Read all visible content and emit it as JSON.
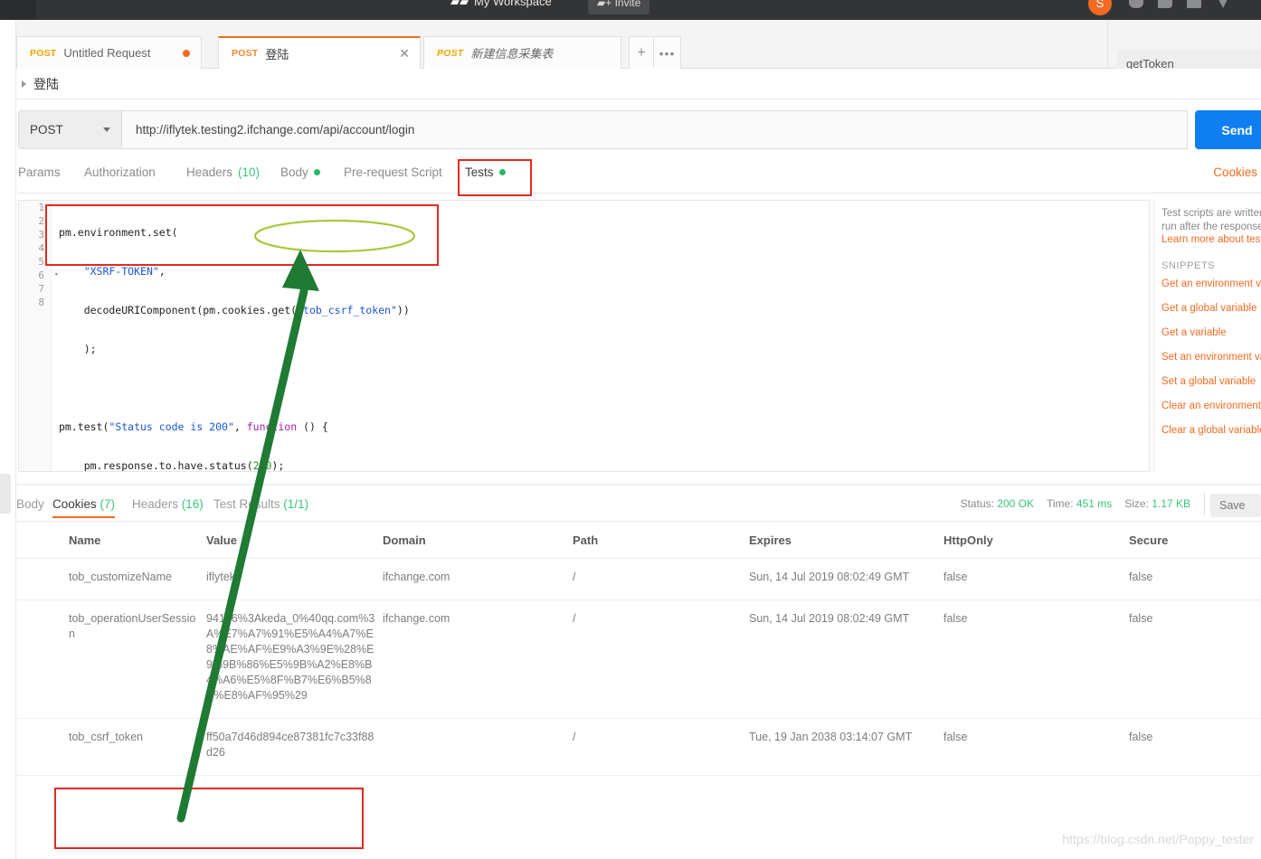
{
  "topbar": {
    "workspace_label": "My Workspace",
    "invite_label": "Invite",
    "avatar_initial": "S"
  },
  "tabs": [
    {
      "method": "POST",
      "label": "Untitled Request",
      "state": "unsaved"
    },
    {
      "method": "POST",
      "label": "登陆",
      "state": "active"
    },
    {
      "method": "POST",
      "label": "新建信息采集表",
      "state": "italic"
    }
  ],
  "tab_actions": {
    "add": "+",
    "more": "•••"
  },
  "environment": {
    "selected": "getToken"
  },
  "request": {
    "title": "登陆",
    "method": "POST",
    "url": "http://iflytek.testing2.ifchange.com/api/account/login",
    "send_label": "Send",
    "cookies_link": "Cookies",
    "tabs": [
      {
        "label": "Params",
        "count": "",
        "dot": false
      },
      {
        "label": "Authorization",
        "count": "",
        "dot": false
      },
      {
        "label": "Headers",
        "count": "(10)",
        "dot": false
      },
      {
        "label": "Body",
        "count": "",
        "dot": true
      },
      {
        "label": "Pre-request Script",
        "count": "",
        "dot": false
      },
      {
        "label": "Tests",
        "count": "",
        "dot": true
      }
    ]
  },
  "editor": {
    "line_numbers": [
      "1",
      "2",
      "3",
      "4",
      "5",
      "6",
      "7",
      "8"
    ],
    "lines": [
      "pm.environment.set(",
      "    \"XSRF-TOKEN\",",
      "    decodeURIComponent(pm.cookies.get(\"tob_csrf_token\"))",
      "    );",
      "",
      "pm.test(\"Status code is 200\", function () {",
      "    pm.response.to.have.status(200);",
      "});"
    ]
  },
  "snippets": {
    "description_line1": "Test scripts are written i",
    "description_line2": "run after the response i",
    "learn_more": "Learn more about tests",
    "heading": "SNIPPETS",
    "items": [
      "Get an environment var",
      "Get a global variable",
      "Get a variable",
      "Set an environment vari",
      "Set a global variable",
      "Clear an environment va",
      "Clear a global variable"
    ]
  },
  "response": {
    "tabs": [
      {
        "label": "Body",
        "count": ""
      },
      {
        "label": "Cookies",
        "count": "(7)"
      },
      {
        "label": "Headers",
        "count": "(16)"
      },
      {
        "label": "Test Results",
        "count": "(1/1)"
      }
    ],
    "active_tab": "Cookies",
    "status_label": "Status:",
    "status_value": "200 OK",
    "time_label": "Time:",
    "time_value": "451 ms",
    "size_label": "Size:",
    "size_value": "1.17 KB",
    "save_label": "Save"
  },
  "cookies_table": {
    "columns": [
      "Name",
      "Value",
      "Domain",
      "Path",
      "Expires",
      "HttpOnly",
      "Secure"
    ],
    "rows": [
      {
        "name": "tob_customizeName",
        "value": "iflytek",
        "domain": "ifchange.com",
        "path": "/",
        "expires": "Sun, 14 Jul 2019 08:02:49 GMT",
        "httponly": "false",
        "secure": "false"
      },
      {
        "name": "tob_operationUserSession",
        "value": "94176%3Akeda_0%40qq.com%3A%E7%A7%91%E5%A4%A7%E8%AE%AF%E9%A3%9E%28%E9%9B%86%E5%9B%A2%E8%B4%A6%E5%8F%B7%E6%B5%8B%E8%AF%95%29",
        "domain": "ifchange.com",
        "path": "/",
        "expires": "Sun, 14 Jul 2019 08:02:49 GMT",
        "httponly": "false",
        "secure": "false"
      },
      {
        "name": "tob_csrf_token",
        "value": "ff50a7d46d894ce87381fc7c33f88d26",
        "domain": "",
        "path": "/",
        "expires": "Tue, 19 Jan 2038 03:14:07 GMT",
        "httponly": "false",
        "secure": "false"
      }
    ]
  },
  "annotations": {
    "box_color": "#e02b20",
    "ellipse_color": "#a8c83c",
    "arrow_color": "#1f7a34"
  },
  "watermark": "https://blog.csdn.net/Poppy_tester"
}
